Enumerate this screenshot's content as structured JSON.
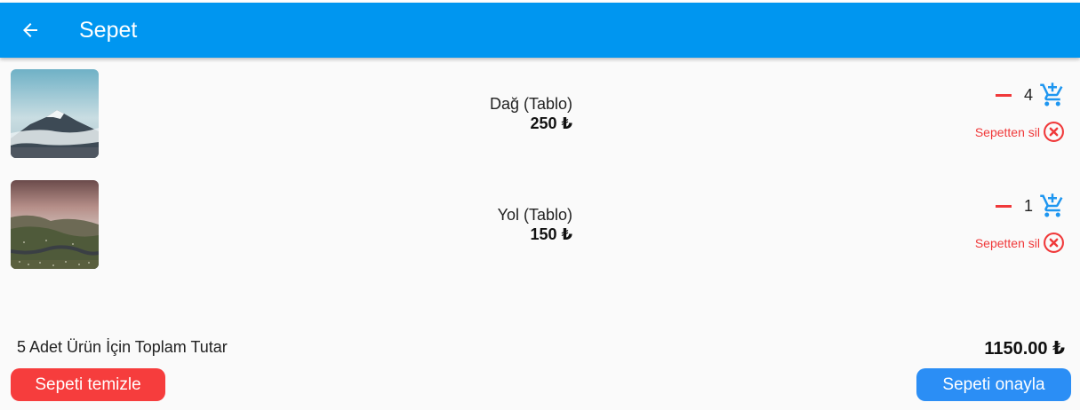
{
  "appbar": {
    "title": "Sepet",
    "back_icon": "arrow-back-icon",
    "background": "#0096f0"
  },
  "items": [
    {
      "name": "Dağ (Tablo)",
      "price": "250 ₺",
      "quantity": "4",
      "remove_label": "Sepetten sil",
      "image": "mountain-painting"
    },
    {
      "name": "Yol (Tablo)",
      "price": "150 ₺",
      "quantity": "1",
      "remove_label": "Sepetten sil",
      "image": "road-painting"
    }
  ],
  "summary": {
    "label": "5 Adet Ürün İçin Toplam Tutar",
    "total": "1150.00 ₺"
  },
  "actions": {
    "clear_label": "Sepeti temizle",
    "confirm_label": "Sepeti onayla"
  },
  "colors": {
    "danger": "#f0393a",
    "accent": "#2b8ef5",
    "cart_icon": "#1e96f0"
  }
}
